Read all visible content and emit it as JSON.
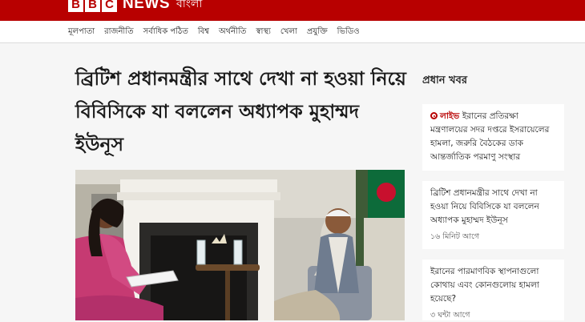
{
  "header": {
    "logo_letters": [
      "B",
      "B",
      "C"
    ],
    "news_word": "NEWS",
    "lang_word": "বাংলা",
    "brand_color": "#b80000"
  },
  "nav": {
    "items": [
      "মূলপাতা",
      "রাজনীতি",
      "সর্বাধিক পঠিত",
      "বিশ্ব",
      "অর্থনীতি",
      "স্বাস্থ্য",
      "খেলা",
      "প্রযুক্তি",
      "ভিডিও"
    ]
  },
  "article": {
    "headline": "ব্রিটিশ প্রধানমন্ত্রীর সাথে দেখা না হওয়া নিয়ে বিবিসিকে যা বললেন অধ্যাপক মুহাম্মদ ইউনূস",
    "image_icon": "interview-photo"
  },
  "sidebar": {
    "title": "প্রধান খবর",
    "cards": [
      {
        "live_label": "লাইভ",
        "text": "ইরানের প্রতিরক্ষা মন্ত্রণালয়ের সদর দপ্তরে ইসরায়েলের হামলা, জরুরি বৈঠকের ডাক আন্তর্জাতিক পরমাণু সংস্থার",
        "time": ""
      },
      {
        "live_label": "",
        "text": "ব্রিটিশ প্রধানমন্ত্রীর সাথে দেখা না হওয়া নিয়ে বিবিসিকে যা বললেন অধ্যাপক মুহাম্মদ ইউনূস",
        "time": "১৬ মিনিট আগে"
      },
      {
        "live_label": "",
        "text": "ইরানের পারমাণবিক স্থাপনাগুলো কোথায় এবং কোনগুলোয় হামলা হয়েছে?",
        "time": "৩ ঘন্টা আগে"
      }
    ]
  }
}
